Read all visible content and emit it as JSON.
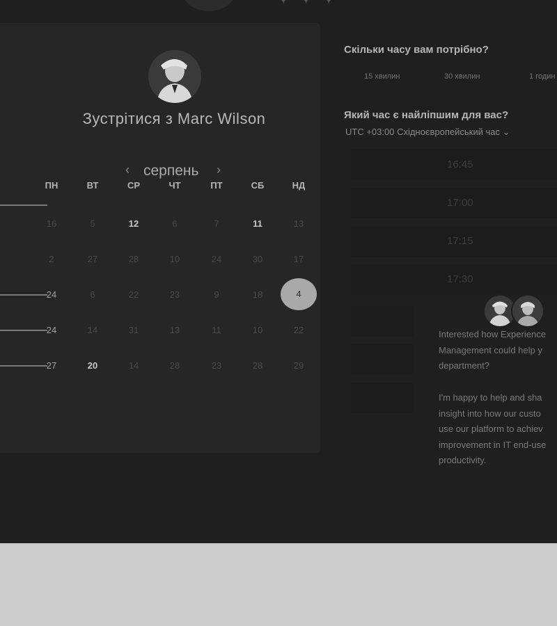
{
  "meeting": {
    "title": "Зустрітися з Marc Wilson",
    "month": "серпень",
    "prev_icon": "chevron-left-icon",
    "next_icon": "chevron-right-icon"
  },
  "calendar": {
    "weekdays": [
      "ПН",
      "ВТ",
      "СР",
      "ЧТ",
      "ПТ",
      "СБ",
      "НД"
    ],
    "rows": [
      [
        "16",
        "5",
        "12",
        "6",
        "7",
        "11",
        "13"
      ],
      [
        "2",
        "27",
        "28",
        "10",
        "24",
        "30",
        "17"
      ],
      [
        "24",
        "6",
        "22",
        "23",
        "9",
        "18",
        "4"
      ],
      [
        "24",
        "14",
        "31",
        "13",
        "11",
        "10",
        "22"
      ],
      [
        "27",
        "20",
        "14",
        "28",
        "23",
        "28",
        "29"
      ]
    ],
    "selected": "4"
  },
  "duration": {
    "question": "Скільки часу вам потрібно?",
    "options": [
      "15 хвилин",
      "30 хвилин",
      "1 годин"
    ]
  },
  "time": {
    "question": "Який час є найліпшим для вас?",
    "timezone": "UTC +03:00 Східноєвропейський час  ⌄",
    "slots": [
      "16:45",
      "17:00",
      "17:15",
      "17:30"
    ]
  },
  "message": {
    "p1": "Interested how Experience\nManagement could help y\ndepartment?",
    "p2": "I'm happy to help and sha\ninsight into how our custo\nuse our platform to achiev\nimprovement in IT end-use\nproductivity."
  }
}
